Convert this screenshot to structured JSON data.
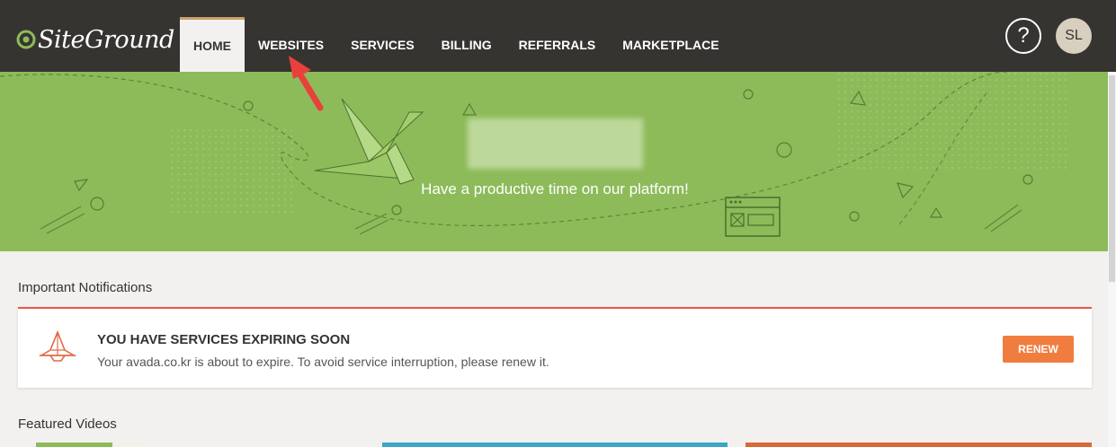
{
  "brand": {
    "name": "SiteGround"
  },
  "nav": {
    "items": [
      {
        "label": "HOME",
        "active": true
      },
      {
        "label": "WEBSITES",
        "active": false
      },
      {
        "label": "SERVICES",
        "active": false
      },
      {
        "label": "BILLING",
        "active": false
      },
      {
        "label": "REFERRALS",
        "active": false
      },
      {
        "label": "MARKETPLACE",
        "active": false
      }
    ]
  },
  "header": {
    "help_icon": "?",
    "avatar_initials": "SL"
  },
  "hero": {
    "tagline": "Have a productive time on our platform!"
  },
  "notifications": {
    "section_title": "Important Notifications",
    "title": "YOU HAVE SERVICES EXPIRING SOON",
    "message": "Your avada.co.kr is about to expire. To avoid service interruption, please renew it.",
    "action_label": "RENEW"
  },
  "videos": {
    "section_title": "Featured Videos"
  },
  "colors": {
    "topbar": "#363431",
    "hero": "#8dbb5a",
    "accent_orange": "#f07d3f",
    "alert_red": "#e25a4a"
  }
}
